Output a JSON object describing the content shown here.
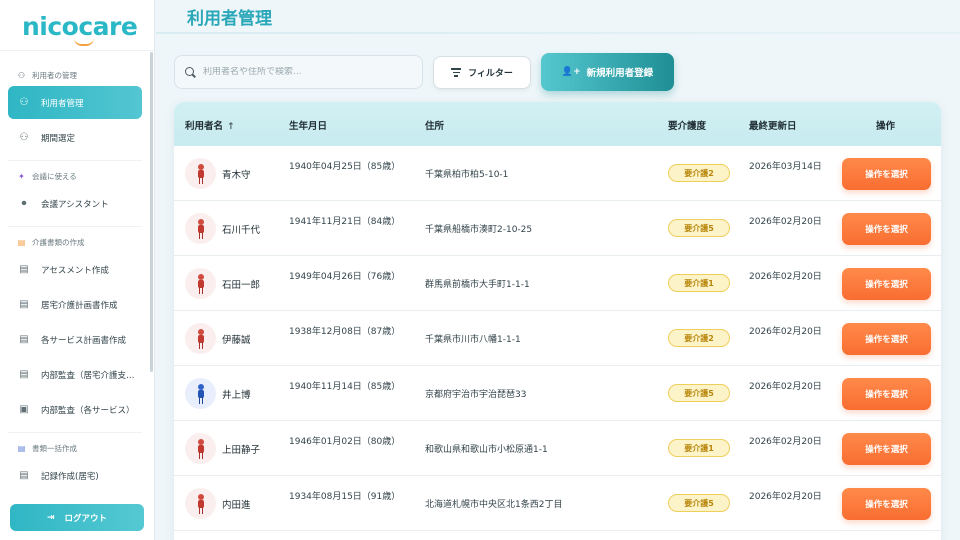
{
  "app": {
    "logo_text": "nicocare",
    "page_title": "利用者管理"
  },
  "sidebar": {
    "sections": [
      {
        "label": "利用者の管理",
        "icon": "users-icon",
        "items": [
          {
            "label": "利用者管理",
            "icon": "users-icon",
            "active": true
          },
          {
            "label": "期間選定",
            "icon": "users-icon",
            "active": false
          }
        ]
      },
      {
        "label": "会議に使える",
        "icon": "sparkle-icon",
        "items": [
          {
            "label": "会議アシスタント",
            "icon": "microphone-icon",
            "active": false
          }
        ]
      },
      {
        "label": "介護書類の作成",
        "icon": "document-icon",
        "items": [
          {
            "label": "アセスメント作成",
            "icon": "document-icon",
            "active": false
          },
          {
            "label": "居宅介護計画書作成",
            "icon": "document-icon",
            "active": false
          },
          {
            "label": "各サービス計画書作成",
            "icon": "document-icon",
            "active": false
          },
          {
            "label": "内部監査（居宅介護支…",
            "icon": "document-icon",
            "active": false
          },
          {
            "label": "内部監査（各サービス）",
            "icon": "clipboard-icon",
            "active": false
          }
        ]
      },
      {
        "label": "書類一括作成",
        "icon": "document-icon",
        "items": [
          {
            "label": "記録作成(居宅)",
            "icon": "document-icon",
            "active": false
          }
        ]
      }
    ],
    "logout_label": "ログアウト"
  },
  "toolbar": {
    "search_placeholder": "利用者名や住所で検索...",
    "filter_label": "フィルター",
    "new_user_label": "新規利用者登録"
  },
  "table": {
    "headers": {
      "name": "利用者名",
      "dob": "生年月日",
      "address": "住所",
      "care_level": "要介護度",
      "updated": "最終更新日",
      "action": "操作"
    },
    "sort_indicator": "↑",
    "rows": [
      {
        "name": "青木守",
        "gender": "female",
        "dob": "1940年04月25日（85歳）",
        "address": "千葉県柏市柏5-10-1",
        "care_level": "要介護2",
        "updated": "2026年03月14日",
        "action": "操作を選択"
      },
      {
        "name": "石川千代",
        "gender": "female",
        "dob": "1941年11月21日（84歳）",
        "address": "千葉県船橋市湊町2-10-25",
        "care_level": "要介護5",
        "updated": "2026年02月20日",
        "action": "操作を選択"
      },
      {
        "name": "石田一郎",
        "gender": "female",
        "dob": "1949年04月26日（76歳）",
        "address": "群馬県前橋市大手町1-1-1",
        "care_level": "要介護1",
        "updated": "2026年02月20日",
        "action": "操作を選択"
      },
      {
        "name": "伊藤誠",
        "gender": "female",
        "dob": "1938年12月08日（87歳）",
        "address": "千葉県市川市八幡1-1-1",
        "care_level": "要介護2",
        "updated": "2026年02月20日",
        "action": "操作を選択"
      },
      {
        "name": "井上博",
        "gender": "male",
        "dob": "1940年11月14日（85歳）",
        "address": "京都府宇治市宇治琵琶33",
        "care_level": "要介護5",
        "updated": "2026年02月20日",
        "action": "操作を選択"
      },
      {
        "name": "上田静子",
        "gender": "female",
        "dob": "1946年01月02日（80歳）",
        "address": "和歌山県和歌山市小松原通1-1",
        "care_level": "要介護1",
        "updated": "2026年02月20日",
        "action": "操作を選択"
      },
      {
        "name": "内田進",
        "gender": "female",
        "dob": "1934年08月15日（91歳）",
        "address": "北海道札幌市中央区北1条西2丁目",
        "care_level": "要介護5",
        "updated": "2026年02月20日",
        "action": "操作を選択"
      }
    ]
  },
  "colors": {
    "accent": "#2fb6c4",
    "action": "#f96d31",
    "badge_bg": "#fdf3c8",
    "badge_text": "#b8860b"
  }
}
